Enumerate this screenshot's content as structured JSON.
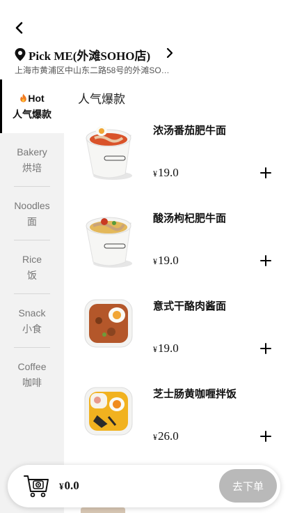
{
  "header": {
    "back_icon": "chevron-left-icon"
  },
  "store": {
    "name": "Pick ME(外滩SOHO店)",
    "address": "上海市黄浦区中山东二路58号的外滩SO…",
    "pin_icon": "location-pin-icon",
    "arrow_icon": "chevron-right-icon"
  },
  "sidebar": {
    "categories": [
      {
        "en": "Hot",
        "zh": "人气爆款",
        "active": true,
        "icon": "fire-icon"
      },
      {
        "en": "Bakery",
        "zh": "烘培"
      },
      {
        "en": "Noodles",
        "zh": "面"
      },
      {
        "en": "Rice",
        "zh": "饭"
      },
      {
        "en": "Snack",
        "zh": "小食"
      },
      {
        "en": "Coffee",
        "zh": "咖啡"
      }
    ]
  },
  "section": {
    "title": "人气爆款"
  },
  "menu": {
    "items": [
      {
        "name": "浓汤番茄肥牛面",
        "currency": "¥",
        "price": "19.0"
      },
      {
        "name": "酸汤枸杞肥牛面",
        "currency": "¥",
        "price": "19.0"
      },
      {
        "name": "意式干酪肉酱面",
        "currency": "¥",
        "price": "19.0"
      },
      {
        "name": "芝士肠黄咖喱拌饭",
        "currency": "¥",
        "price": "26.0"
      }
    ]
  },
  "cart": {
    "currency": "¥",
    "total": "0.0",
    "checkout_label": "去下单",
    "icon": "shopping-cart-icon"
  },
  "colors": {
    "active_indicator": "#000000",
    "sidebar_bg": "#f2f2f2",
    "checkout_disabled": "#b9b9b9"
  }
}
